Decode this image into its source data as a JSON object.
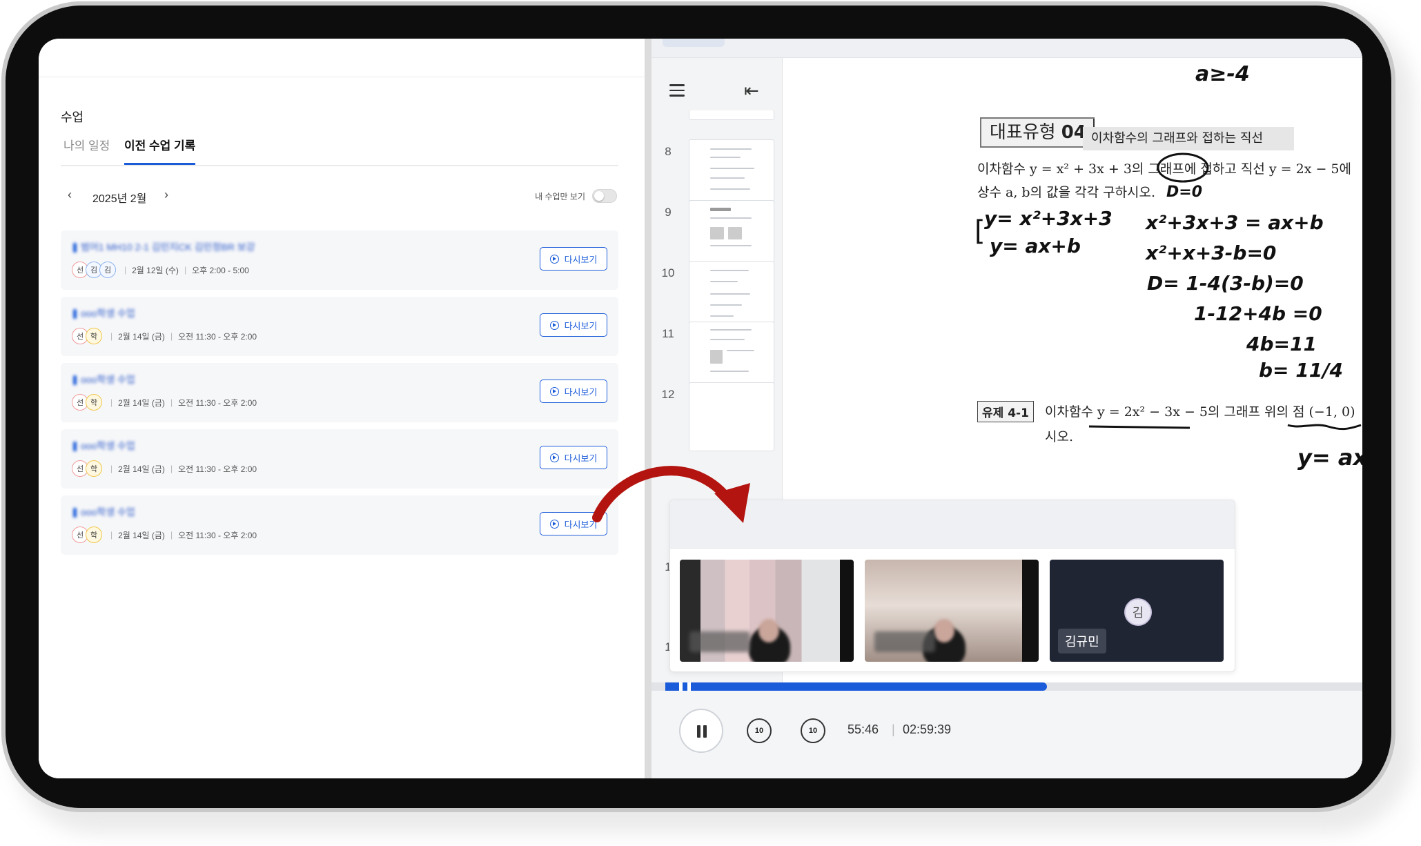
{
  "left_panel": {
    "section_title": "수업",
    "tabs": [
      {
        "label": "나의 일정",
        "active": false
      },
      {
        "label": "이전 수업 기록",
        "active": true
      }
    ],
    "month_nav": {
      "label": "2025년 2월",
      "prev": "‹",
      "next": "›"
    },
    "toggle": {
      "label": "내 수업만 보기",
      "on": false
    },
    "classes": [
      {
        "title": "범어1 MH10 2-1 김민지CK 김민정BR 보강",
        "avatars": [
          "선",
          "김",
          "김"
        ],
        "date": "2월 12일 (수)",
        "time": "오후 2:00 - 5:00",
        "button": "다시보기"
      },
      {
        "title": "ooo학생 수업",
        "avatars": [
          "선",
          "학"
        ],
        "date": "2월 14일 (금)",
        "time": "오전 11:30 - 오후 2:00",
        "button": "다시보기"
      },
      {
        "title": "ooo학생 수업",
        "avatars": [
          "선",
          "학"
        ],
        "date": "2월 14일 (금)",
        "time": "오전 11:30 - 오후 2:00",
        "button": "다시보기"
      },
      {
        "title": "ooo학생 수업",
        "avatars": [
          "선",
          "학"
        ],
        "date": "2월 14일 (금)",
        "time": "오전 11:30 - 오후 2:00",
        "button": "다시보기"
      },
      {
        "title": "ooo학생 수업",
        "avatars": [
          "선",
          "학"
        ],
        "date": "2월 14일 (금)",
        "time": "오전 11:30 - 오후 2:00",
        "button": "다시보기"
      }
    ]
  },
  "viewer": {
    "thumbnails": [
      "8",
      "9",
      "10",
      "11",
      "12"
    ],
    "extra_page_numbers": [
      "1",
      "1"
    ],
    "document": {
      "tag_label": "대표유형",
      "tag_number": "04",
      "tag_subtitle": "이차함수의 그래프와 접하는 직선",
      "problem_line1": "이차함수 y = x² + 3x + 3의 그래프에 접하고 직선 y = 2x − 5에",
      "problem_line2": "상수 a, b의 값을 각각 구하시오.",
      "sub_label": "유제 4-1",
      "sub_line1": "이차함수 y = 2x² − 3x − 5의 그래프 위의 점 (−1, 0)",
      "sub_line2": "시오.",
      "handwriting": {
        "top": "a≥-4",
        "circle_note": "D=0",
        "sys1": "y= x²+3x+3",
        "sys2": "y= ax+b",
        "eq1": "x²+3x+3 = ax+b",
        "eq2": "x²+x+3-b=0",
        "eq3": "D= 1-4(3-b)=0",
        "eq4": "1-12+4b =0",
        "eq5": "4b=11",
        "eq6": "b= 11/4",
        "bottom": "y= ax"
      }
    },
    "participants": [
      {
        "name": "",
        "type": "video"
      },
      {
        "name": "",
        "type": "video"
      },
      {
        "name": "김규민",
        "initial": "김",
        "type": "avatar"
      }
    ],
    "player": {
      "current_time": "55:46",
      "separator": "|",
      "total_time": "02:59:39",
      "skip_back": "10",
      "skip_fwd": "10",
      "progress": 0.31
    }
  },
  "colors": {
    "accent": "#1a5bd9",
    "arrow": "#b3140f"
  }
}
